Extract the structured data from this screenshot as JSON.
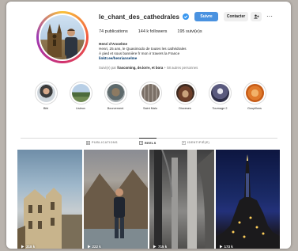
{
  "profile": {
    "username": "le_chant_des_cathedrales",
    "follow_label": "Suivre",
    "contact_label": "Contacter",
    "stats": {
      "posts": "74 publications",
      "followers": "144 k followers",
      "following": "195 suivi(e)s"
    },
    "bio": {
      "name": "Henri d'Anselme",
      "line1": "Henri, 25 ans, le Quasimodo de toutes les cathédrales",
      "line2": "À pied et sous bannière fr mon ir travers la France",
      "link": "linktr.ee/henrianselme"
    },
    "followed_by_prefix": "Suivi(e) par",
    "followed_by_names": "frascoming, de.lorre, et bora",
    "followed_by_suffix": "+ 58 autres personnes"
  },
  "highlights": [
    {
      "label": "Bibi"
    },
    {
      "label": "Lisieux"
    },
    {
      "label": "Bourvement"
    },
    {
      "label": "Saint Malo"
    },
    {
      "label": "Dioceses"
    },
    {
      "label": "Tournage 2"
    },
    {
      "label": "Goupillons"
    }
  ],
  "tabs": [
    {
      "label": "PUBLICATIONS"
    },
    {
      "label": "REELS"
    },
    {
      "label": "IDENTIFIÉ(E)"
    }
  ],
  "reels": [
    {
      "views": "318 k"
    },
    {
      "views": "222 k"
    },
    {
      "views": "715 k"
    },
    {
      "views": "173 k"
    }
  ],
  "colors": {
    "accent": "#4a92e0",
    "verified": "#3897f0",
    "text": "#262626",
    "muted": "#737373"
  }
}
